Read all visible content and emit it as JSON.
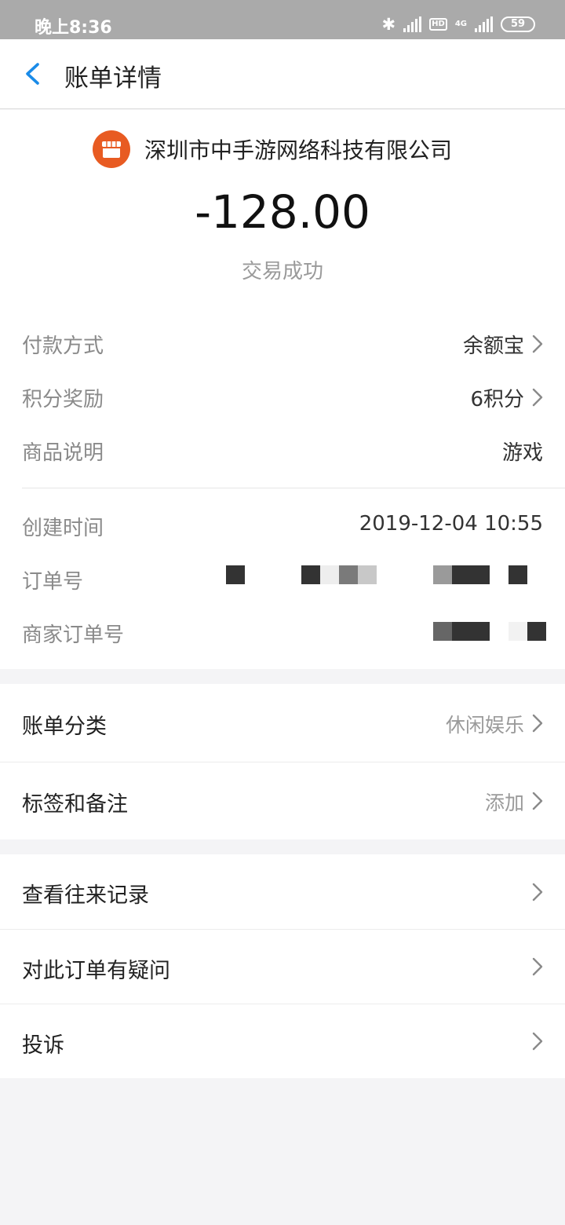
{
  "status_bar": {
    "time": "晚上8:36",
    "icons": [
      "bluetooth-icon",
      "signal-icon",
      "hd-icon",
      "4g-signal-icon",
      "battery-icon"
    ],
    "hd_label": "HD",
    "network": "4G",
    "battery": "59"
  },
  "nav": {
    "back_icon": "chevron-left-icon",
    "title": "账单详情",
    "accent": "#1a8be8"
  },
  "header": {
    "merchant_icon": "store-icon",
    "merchant_color": "#e85b22",
    "merchant": "深圳市中手游网络科技有限公司",
    "amount": "-128.00",
    "status": "交易成功"
  },
  "details": {
    "payment_method_label": "付款方式",
    "payment_method_value": "余额宝",
    "points_label": "积分奖励",
    "points_value": "6积分",
    "product_label": "商品说明",
    "product_value": "游戏"
  },
  "order": {
    "created_label": "创建时间",
    "created_value": "2019-12-04 10:55",
    "order_no_label": "订单号",
    "merchant_order_no_label": "商家订单号"
  },
  "category": {
    "label": "账单分类",
    "value": "休闲娱乐"
  },
  "tags": {
    "label": "标签和备注",
    "value": "添加"
  },
  "actions": {
    "history": "查看往来记录",
    "question": "对此订单有疑问",
    "complaint": "投诉"
  }
}
